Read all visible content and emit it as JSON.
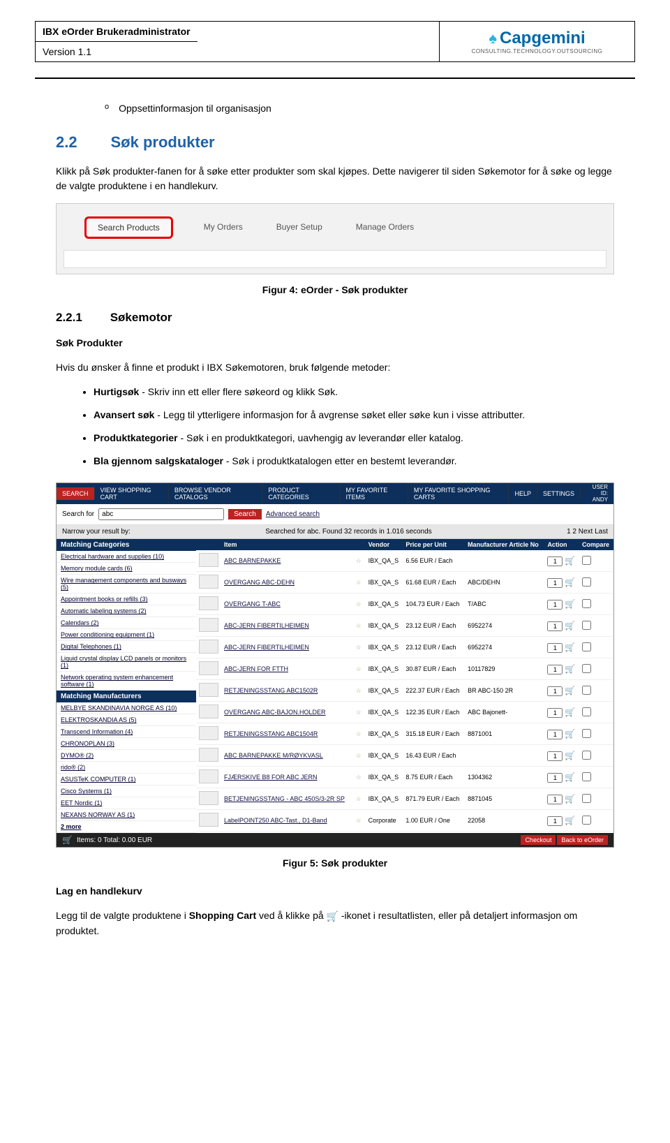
{
  "doc": {
    "title": "IBX eOrder Brukeradministrator",
    "version": "Version 1.1",
    "logo_main": "Capgemini",
    "logo_sub": "CONSULTING.TECHNOLOGY.OUTSOURCING"
  },
  "bullet_o": "Oppsettinformasjon til organisasjon",
  "sec22_num": "2.2",
  "sec22_title": "Søk produkter",
  "para1": "Klikk på Søk produkter-fanen for å søke etter produkter som skal kjøpes. Dette navigerer til siden Søkemotor for å søke og legge de valgte produktene i en handlekurv.",
  "tabs": {
    "search": "Search Products",
    "myorders": "My Orders",
    "buyer": "Buyer Setup",
    "manage": "Manage Orders"
  },
  "caption4": "Figur 4: eOrder - Søk produkter",
  "sec221_num": "2.2.1",
  "sec221_title": "Søkemotor",
  "subhead": "Søk Produkter",
  "para2": "Hvis du ønsker å finne et produkt i IBX Søkemotoren, bruk følgende metoder:",
  "b1_bold": "Hurtigsøk",
  "b1_rest": " - Skriv inn ett eller flere søkeord og klikk Søk.",
  "b2_bold": "Avansert søk",
  "b2_rest": " - Legg til ytterligere informasjon for å avgrense søket eller søke kun i visse attributter.",
  "b3_bold": "Produktkategorier",
  "b3_rest": " - Søk i en produktkategori, uavhengig av leverandør eller katalog.",
  "b4_bold": "Bla gjennom salgskataloger",
  "b4_rest": " - Søk i produktkatalogen etter en bestemt leverandør.",
  "app": {
    "nav": {
      "search": "SEARCH",
      "cart": "VIEW SHOPPING CART",
      "browse": "BROWSE VENDOR CATALOGS",
      "cats": "PRODUCT CATEGORIES",
      "fav": "MY FAVORITE ITEMS",
      "favc": "MY FAVORITE SHOPPING CARTS",
      "help": "HELP",
      "settings": "SETTINGS",
      "userlabel": "USER ID:",
      "userval": "ANDY"
    },
    "searchfor": "Search for",
    "searchval": "abc",
    "searchbtn": "Search",
    "advsearch": "Advanced search",
    "narrow": "Narrow your result by:",
    "searched": "Searched for abc. Found 32 records in 1.016 seconds",
    "pager": "1 2 Next Last",
    "side": {
      "cat_head": "Matching Categories",
      "cats": [
        "Electrical hardware and supplies (10)",
        "Memory module cards (6)",
        "Wire management components and busways (5)",
        "Appointment books or refills (3)",
        "Automatic labeling systems (2)",
        "Calendars (2)",
        "Power conditioning equipment (1)",
        "Digital Telephones (1)",
        "Liquid crystal display LCD panels or monitors (1)",
        "Network operating system enhancement software (1)"
      ],
      "man_head": "Matching Manufacturers",
      "mans": [
        "MELBYE SKANDINAVIA NORGE AS (10)",
        "ELEKTROSKANDIA AS (5)",
        "Transcend Information (4)",
        "CHRONOPLAN (3)",
        "DYMO® (2)",
        "rido® (2)",
        "ASUSTeK COMPUTER (1)",
        "Cisco Systems (1)",
        "EET Nordic (1)",
        "NEXANS NORWAY AS (1)"
      ],
      "more": "2 more"
    },
    "th": {
      "item": "Item",
      "vendor": "Vendor",
      "price": "Price per Unit",
      "manu": "Manufacturer Article No",
      "action": "Action",
      "compare": "Compare"
    },
    "rows": [
      {
        "name": "ABC BARNEPAKKE",
        "vendor": "IBX_QA_S",
        "price": "6.56 EUR / Each",
        "manu": ""
      },
      {
        "name": "OVERGANG ABC-DEHN",
        "vendor": "IBX_QA_S",
        "price": "61.68 EUR / Each",
        "manu": "ABC/DEHN"
      },
      {
        "name": "OVERGANG T-ABC",
        "vendor": "IBX_QA_S",
        "price": "104.73 EUR / Each",
        "manu": "T/ABC"
      },
      {
        "name": "ABC-JERN FIBERTILHEIMEN",
        "vendor": "IBX_QA_S",
        "price": "23.12 EUR / Each",
        "manu": "6952274"
      },
      {
        "name": "ABC-JERN FIBERTILHEIMEN",
        "vendor": "IBX_QA_S",
        "price": "23.12 EUR / Each",
        "manu": "6952274"
      },
      {
        "name": "ABC-JERN FOR FTTH",
        "vendor": "IBX_QA_S",
        "price": "30.87 EUR / Each",
        "manu": "10117829"
      },
      {
        "name": "RETJENINGSSTANG ABC1502R",
        "vendor": "IBX_QA_S",
        "price": "222.37 EUR / Each",
        "manu": "BR ABC-150 2R"
      },
      {
        "name": "OVERGANG ABC-BAJON.HOLDER",
        "vendor": "IBX_QA_S",
        "price": "122.35 EUR / Each",
        "manu": "ABC Bajonett-"
      },
      {
        "name": "RETJENINGSSTANG ABC1504R",
        "vendor": "IBX_QA_S",
        "price": "315.18 EUR / Each",
        "manu": "8871001"
      },
      {
        "name": "ABC BARNEPAKKE M/RØYKVASL",
        "vendor": "IBX_QA_S",
        "price": "16.43 EUR / Each",
        "manu": ""
      },
      {
        "name": "FJÆRSKIVE B8 FOR ABC JERN",
        "vendor": "IBX_QA_S",
        "price": "8.75 EUR / Each",
        "manu": "1304362"
      },
      {
        "name": "BETJENINGSSTANG - ABC 450S/3-2R SP",
        "vendor": "IBX_QA_S",
        "price": "871.79 EUR / Each",
        "manu": "8871045"
      },
      {
        "name": "LabelPOINT250 ABC-Tast., D1-Band",
        "vendor": "Corporate",
        "price": "1.00 EUR / One",
        "manu": "22058"
      }
    ],
    "footer_items": "Items: 0  Total: 0.00 EUR",
    "checkout": "Checkout",
    "back": "Back to eOrder"
  },
  "caption5": "Figur 5: Søk produkter",
  "lag": "Lag en handlekurv",
  "para3a": "Legg til de valgte produktene i ",
  "para3b": "Shopping Cart",
  "para3c": " ved å klikke på ",
  "para3d": " -ikonet i resultatlisten, eller på detaljert informasjon om produktet."
}
